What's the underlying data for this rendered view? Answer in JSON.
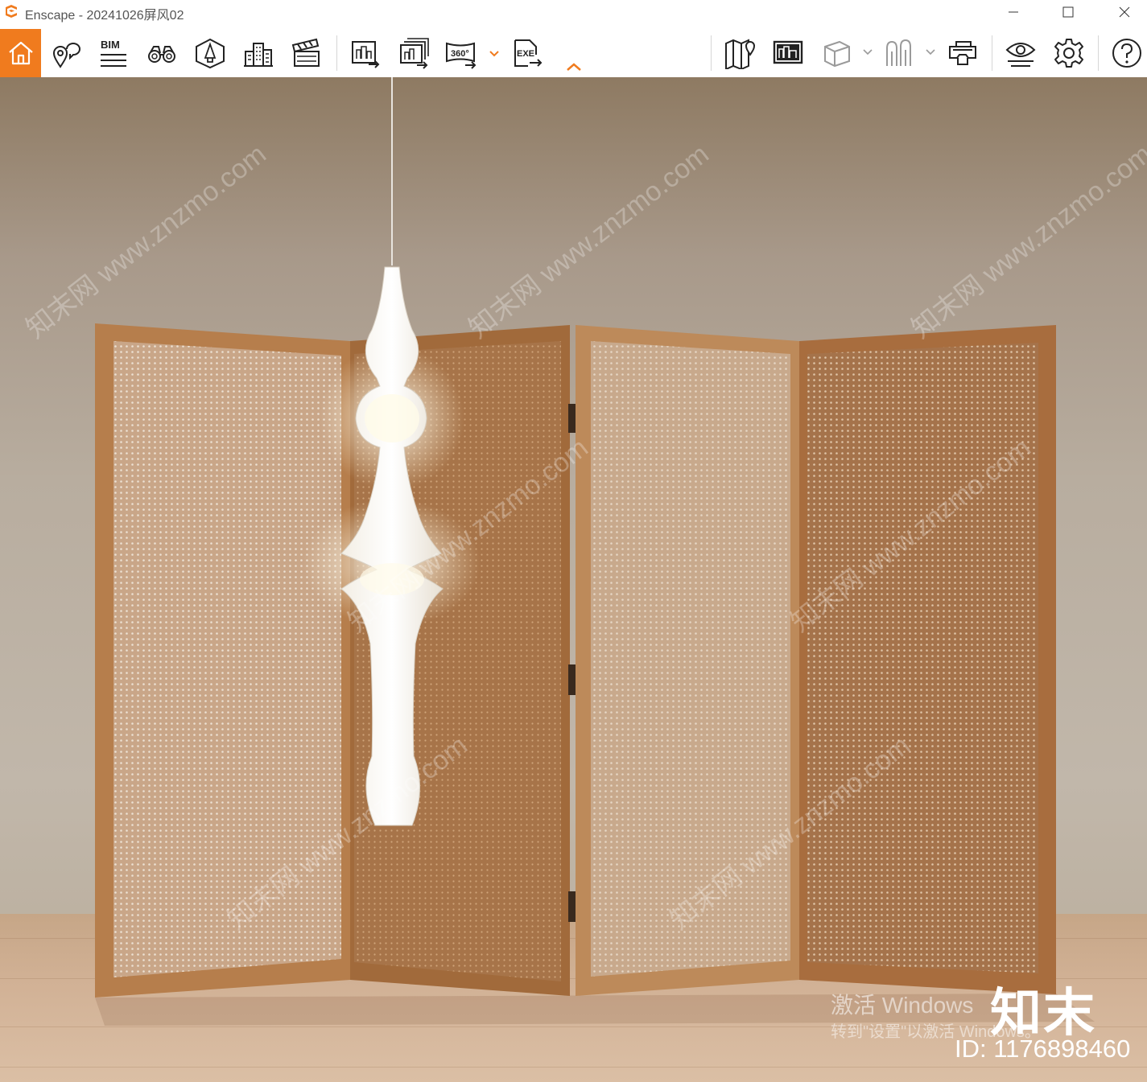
{
  "window": {
    "title": "Enscape - 20241026屏风02",
    "controls": {
      "minimize": "minimize",
      "maximize": "maximize",
      "close": "close"
    }
  },
  "toolbar": {
    "bim_label": "BIM",
    "panorama_label": "360°",
    "exe_label": "EXE",
    "buttons": [
      "home",
      "views-and-locations",
      "bim",
      "binoculars",
      "asset-library",
      "buildings",
      "video-editor",
      "screenshot",
      "batch-render",
      "panorama-360",
      "export-exe",
      "collapse-toolbar",
      "map",
      "site-context",
      "visual-preset",
      "atmosphere",
      "vr-headset",
      "view-mode",
      "settings",
      "help"
    ],
    "accent_color": "#f07b1e"
  },
  "viewport": {
    "watermark_text": "知末网 www.znzmo.com",
    "activation_title": "激活 Windows",
    "activation_subtitle": "转到\"设置\"以激活 Windows。",
    "brand": "知末",
    "image_id": "ID: 1176898460"
  }
}
